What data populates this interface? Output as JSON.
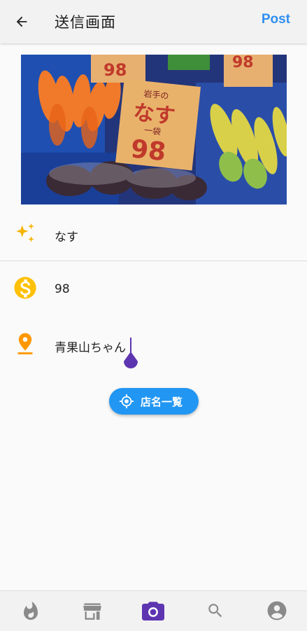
{
  "appbar": {
    "title": "送信画面",
    "post_label": "Post"
  },
  "photo": {
    "sign_main_top": "98",
    "sign_center_small": "岩手の",
    "sign_center_big": "なす",
    "sign_center_unit": "一袋",
    "sign_center_price": "98",
    "sign_right_price": "98"
  },
  "fields": {
    "item_name": "なす",
    "price": "98",
    "shop_name": "青果山ちゃん"
  },
  "shop_list_button": {
    "label": "店名一覧"
  },
  "colors": {
    "accent_blue": "#2f8ef0",
    "button_blue": "#2196f3",
    "sparkle_yellow": "#f4b400",
    "money_yellow": "#ffc107",
    "pin_orange": "#ff9800",
    "nav_active_purple": "#5e35b1",
    "nav_inactive": "#8a8a8a"
  },
  "bottom_nav": {
    "items": [
      {
        "icon": "fire-icon",
        "active": false
      },
      {
        "icon": "store-icon",
        "active": false
      },
      {
        "icon": "camera-icon",
        "active": true
      },
      {
        "icon": "search-icon",
        "active": false
      },
      {
        "icon": "account-icon",
        "active": false
      }
    ]
  }
}
